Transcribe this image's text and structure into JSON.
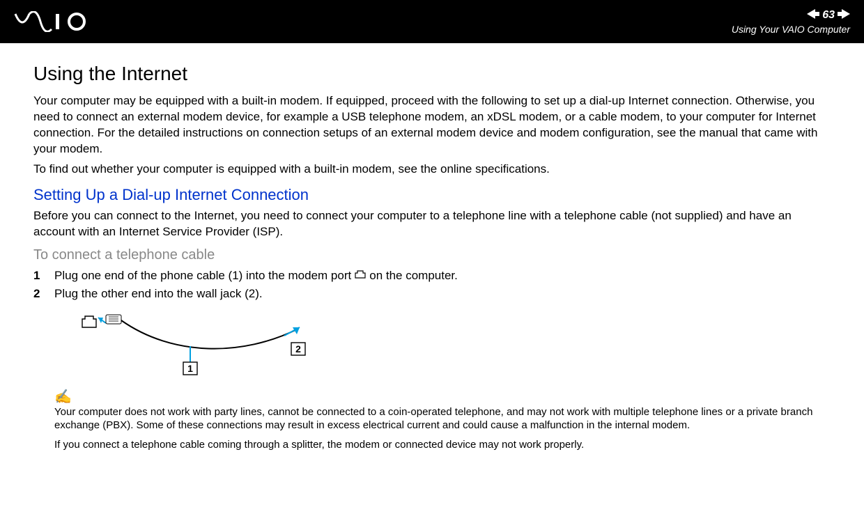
{
  "header": {
    "page_number": "63",
    "section": "Using Your VAIO Computer"
  },
  "title": "Using the Internet",
  "intro_para": "Your computer may be equipped with a built-in modem. If equipped, proceed with the following to set up a dial-up Internet connection. Otherwise, you need to connect an external modem device, for example a USB telephone modem, an xDSL modem, or a cable modem, to your computer for Internet connection. For the detailed instructions on connection setups of an external modem device and modem configuration, see the manual that came with your modem.",
  "intro_para2": "To find out whether your computer is equipped with a built-in modem, see the online specifications.",
  "subheading1": "Setting Up a Dial-up Internet Connection",
  "sub_para1": "Before you can connect to the Internet, you need to connect your computer to a telephone line with a telephone cable (not supplied) and have an account with an Internet Service Provider (ISP).",
  "subheading2": "To connect a telephone cable",
  "steps": [
    {
      "num": "1",
      "text_before": "Plug one end of the phone cable (1) into the modem port",
      "text_after": "on the computer."
    },
    {
      "num": "2",
      "text_before": "Plug the other end into the wall jack (2).",
      "text_after": ""
    }
  ],
  "diagram": {
    "label1": "1",
    "label2": "2"
  },
  "note_icon": "✍",
  "note1": "Your computer does not work with party lines, cannot be connected to a coin-operated telephone, and may not work with multiple telephone lines or a private branch exchange (PBX). Some of these connections may result in excess electrical current and could cause a malfunction in the internal modem.",
  "note2": "If you connect a telephone cable coming through a splitter, the modem or connected device may not work properly."
}
